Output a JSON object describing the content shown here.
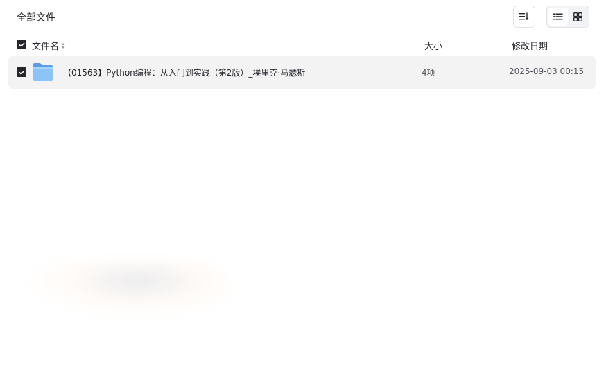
{
  "header": {
    "title": "全部文件",
    "sort_icon": "sort-list-icon",
    "view_options": [
      {
        "icon": "list-view-icon",
        "active": true
      },
      {
        "icon": "grid-view-icon",
        "active": false
      }
    ]
  },
  "columns": {
    "name": "文件名",
    "size": "大小",
    "date": "修改日期"
  },
  "files": [
    {
      "name": "【01563】Python编程：从入门到实践（第2版）_埃里克·马瑟斯",
      "size": "4项",
      "date": "2025-09-03 00:15",
      "type": "folder",
      "checked": true
    }
  ],
  "colors": {
    "checkbox": "#25262b",
    "row_hover": "#f3f3f4",
    "folder": "#7ab7f1"
  }
}
